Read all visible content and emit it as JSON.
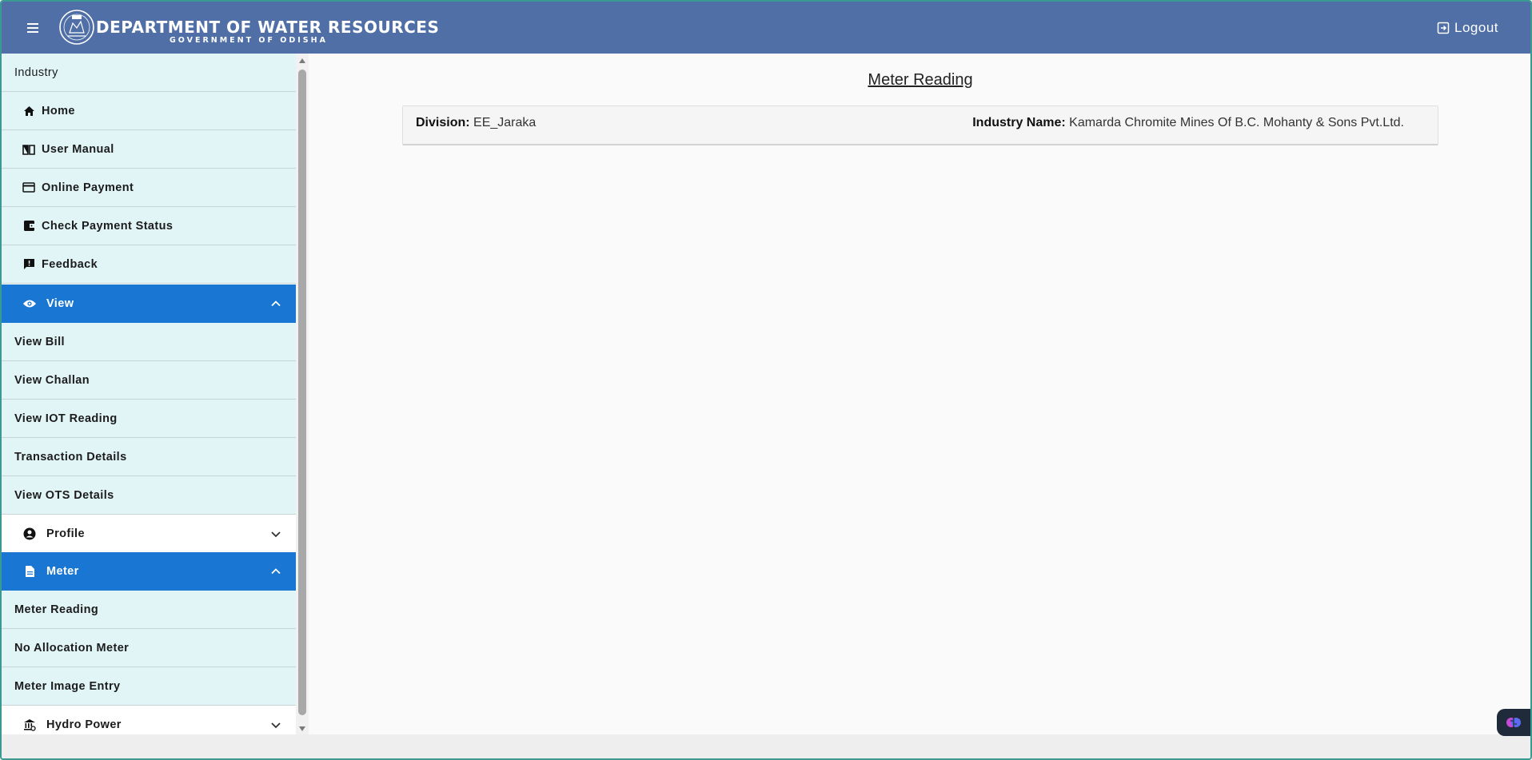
{
  "header": {
    "title": "DEPARTMENT OF WATER RESOURCES",
    "subtitle": "GOVERNMENT OF ODISHA",
    "logout_label": "Logout"
  },
  "sidebar": {
    "top_label": "Industry",
    "items": [
      {
        "label": "Home",
        "icon": "home-icon"
      },
      {
        "label": "User Manual",
        "icon": "book-icon"
      },
      {
        "label": "Online Payment",
        "icon": "credit-card-icon"
      },
      {
        "label": "Check Payment Status",
        "icon": "wallet-icon"
      },
      {
        "label": "Feedback",
        "icon": "feedback-icon"
      }
    ],
    "view_group": {
      "label": "View",
      "items": [
        "View Bill",
        "View Challan",
        "View IOT Reading",
        "Transaction Details",
        "View OTS Details"
      ]
    },
    "profile_group": {
      "label": "Profile"
    },
    "meter_group": {
      "label": "Meter",
      "items": [
        "Meter Reading",
        "No Allocation Meter",
        "Meter Image Entry"
      ]
    },
    "hydro_group": {
      "label": "Hydro Power"
    }
  },
  "main": {
    "page_title": "Meter Reading",
    "division_label": "Division:",
    "division_value": "EE_Jaraka",
    "industry_label": "Industry Name:",
    "industry_value": "Kamarda Chromite Mines Of B.C. Mohanty & Sons Pvt.Ltd."
  },
  "colors": {
    "header_bg": "#4f6fa6",
    "active_group_bg": "#1976d2",
    "nav_item_bg": "#e1f5f7"
  }
}
